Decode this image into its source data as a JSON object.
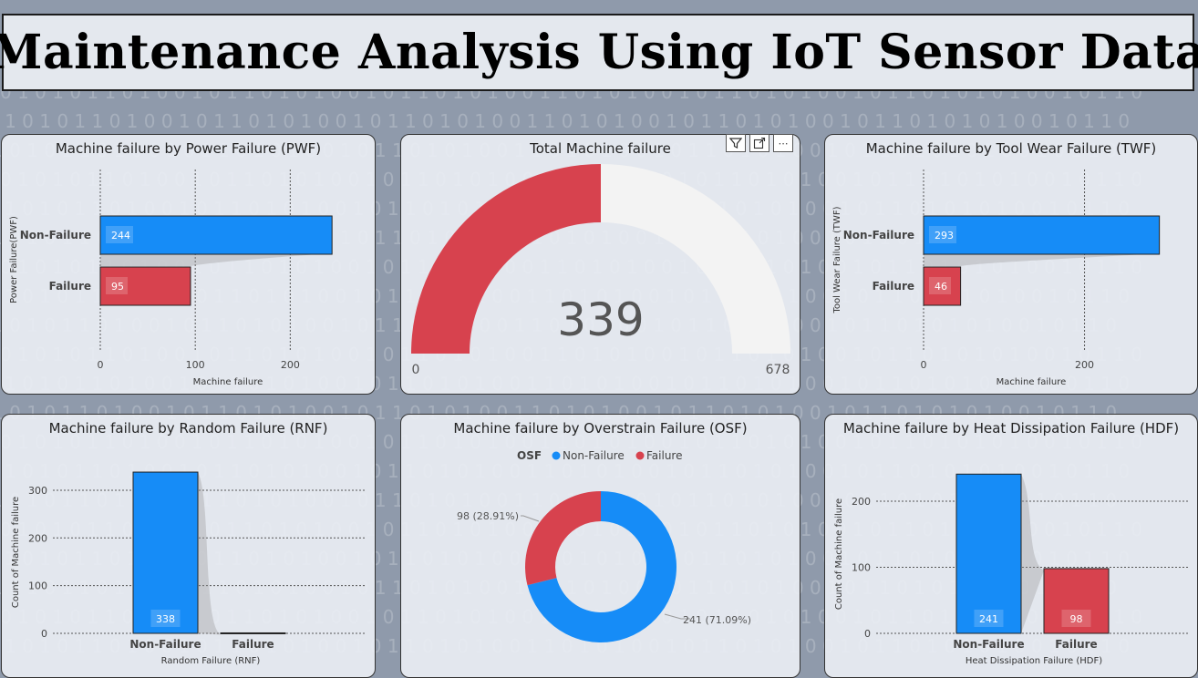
{
  "header": {
    "title": "Maintenance Analysis Using IoT Sensor Data"
  },
  "toolbar": {
    "filter_icon": "filter-icon",
    "focus_icon": "focus-mode-icon",
    "more_icon": "more-options-icon",
    "more_glyph": "⋯"
  },
  "colors": {
    "blue": "#168cf7",
    "red": "#d7424e",
    "track": "#f3f3f3"
  },
  "cards": {
    "pwf": {
      "title": "Machine failure by Power Failure (PWF)"
    },
    "total": {
      "title": "Total Machine failure"
    },
    "twf": {
      "title": "Machine failure by Tool Wear Failure (TWF)"
    },
    "rnf": {
      "title": "Machine failure by Random Failure (RNF)"
    },
    "osf": {
      "title": "Machine failure by Overstrain Failure (OSF)"
    },
    "hdf": {
      "title": "Machine failure by Heat Dissipation Failure (HDF)"
    }
  },
  "chart_data": [
    {
      "id": "pwf",
      "type": "bar",
      "orientation": "horizontal",
      "title": "Machine failure by Power Failure (PWF)",
      "categories": [
        "Non-Failure",
        "Failure"
      ],
      "values": [
        244,
        95
      ],
      "colors": [
        "#168cf7",
        "#d7424e"
      ],
      "xlabel": "Machine failure",
      "ylabel": "Power Failure(PWF)",
      "xlim": [
        0,
        240
      ],
      "ticks": [
        0,
        100,
        200
      ],
      "grid": true
    },
    {
      "id": "total",
      "type": "gauge",
      "title": "Total Machine failure",
      "value": 339,
      "min": 0,
      "max": 678,
      "value_label": "339",
      "min_label": "0",
      "max_label": "678"
    },
    {
      "id": "twf",
      "type": "bar",
      "orientation": "horizontal",
      "title": "Machine failure by Tool Wear Failure (TWF)",
      "categories": [
        "Non-Failure",
        "Failure"
      ],
      "values": [
        293,
        46
      ],
      "colors": [
        "#168cf7",
        "#d7424e"
      ],
      "xlabel": "Machine failure",
      "ylabel": "Tool Wear Failure (TWF)",
      "xlim": [
        0,
        290
      ],
      "ticks": [
        0,
        200
      ],
      "grid": true
    },
    {
      "id": "rnf",
      "type": "bar",
      "orientation": "vertical",
      "title": "Machine failure by Random Failure (RNF)",
      "categories": [
        "Non-Failure",
        "Failure"
      ],
      "values": [
        338,
        1
      ],
      "data_labels": [
        "338",
        ""
      ],
      "colors": [
        "#168cf7",
        "#d7424e"
      ],
      "xlabel": "Random Failure (RNF)",
      "ylabel": "Count of Machine failure",
      "ylim": [
        0,
        340
      ],
      "ticks": [
        0,
        100,
        200,
        300
      ],
      "grid": true
    },
    {
      "id": "osf",
      "type": "pie",
      "donut": true,
      "title": "Machine failure by Overstrain Failure (OSF)",
      "legend_title": "OSF",
      "legend_position": "top",
      "labels": [
        "Non-Failure",
        "Failure"
      ],
      "values": [
        241,
        98
      ],
      "percent_labels": [
        "241 (71.09%)",
        "98 (28.91%)"
      ],
      "colors": [
        "#168cf7",
        "#d7424e"
      ]
    },
    {
      "id": "hdf",
      "type": "bar",
      "orientation": "vertical",
      "title": "Machine failure by Heat Dissipation Failure (HDF)",
      "categories": [
        "Non-Failure",
        "Failure"
      ],
      "values": [
        241,
        98
      ],
      "data_labels": [
        "241",
        "98"
      ],
      "colors": [
        "#168cf7",
        "#d7424e"
      ],
      "xlabel": "Heat Dissipation Failure (HDF)",
      "ylabel": "Count of Machine failure",
      "ylim": [
        0,
        240
      ],
      "ticks": [
        0,
        100,
        200
      ],
      "grid": true
    }
  ]
}
